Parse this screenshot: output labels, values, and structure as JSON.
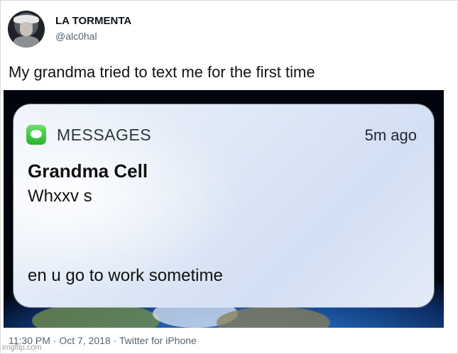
{
  "author": {
    "name": "LA TORMENTA",
    "handle": "@alc0hal"
  },
  "tweet": {
    "text": "My grandma tried to text me for the first time",
    "meta": "11:30 PM · Oct 7, 2018 · Twitter for iPhone"
  },
  "notification": {
    "app_name": "MESSAGES",
    "time_ago": "5m ago",
    "sender": "Grandma Cell",
    "line1": "Whxxv s",
    "line2": "en u go to work sometime"
  },
  "watermark": "imgflip.com",
  "colors": {
    "messages_icon": "#24b52a",
    "secondary_text": "#536471"
  }
}
